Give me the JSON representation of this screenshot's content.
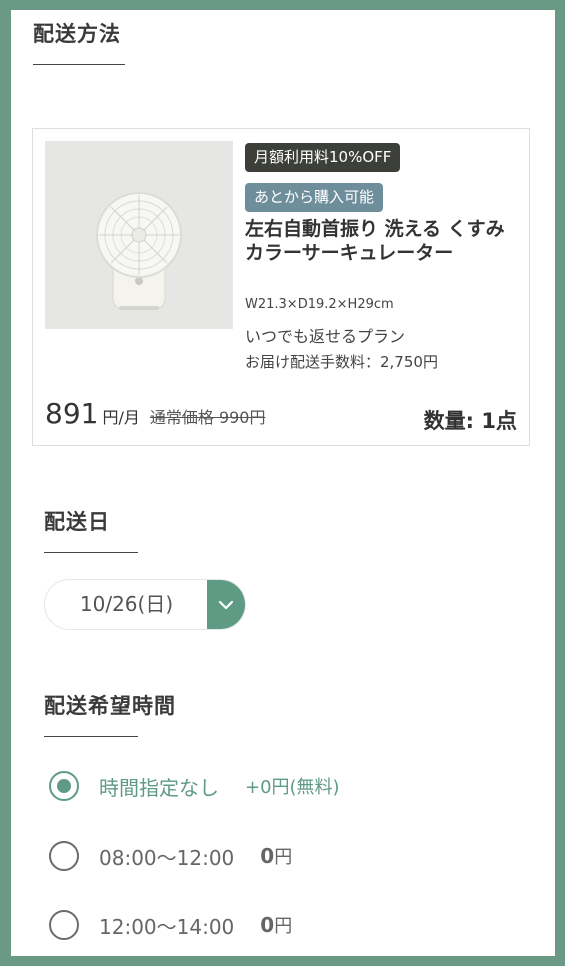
{
  "shipping_method": {
    "title": "配送方法"
  },
  "product": {
    "badge_discount": "月額利用料10%OFF",
    "badge_purchase": "あとから購入可能",
    "name": "左右自動首振り 洗える くすみカラーサーキュレーター",
    "dimensions": "W21.3×D19.2×H29cm",
    "plan": "いつでも返せるプラン",
    "delivery_fee": "お届け配送手数料：2,750円",
    "price": "891",
    "price_unit": "円/月",
    "regular_price": "通常価格 990円",
    "quantity": "数量: 1点",
    "image_icon": "circulator-fan-icon"
  },
  "delivery_date": {
    "title": "配送日",
    "selected": "10/26(日)",
    "dropdown_icon": "chevron-down-icon"
  },
  "delivery_time": {
    "title": "配送希望時間",
    "options": [
      {
        "label": "時間指定なし",
        "price": "+0円(無料)",
        "selected": true
      },
      {
        "label": "08:00〜12:00",
        "price_num": "0",
        "price_unit": "円",
        "selected": false
      },
      {
        "label": "12:00〜14:00",
        "price_num": "0",
        "price_unit": "円",
        "selected": false
      }
    ]
  },
  "colors": {
    "accent": "#5f9a84",
    "frame": "#6a9a86",
    "badge_dark": "#3d3f3a",
    "badge_blue": "#6f8e9c"
  }
}
